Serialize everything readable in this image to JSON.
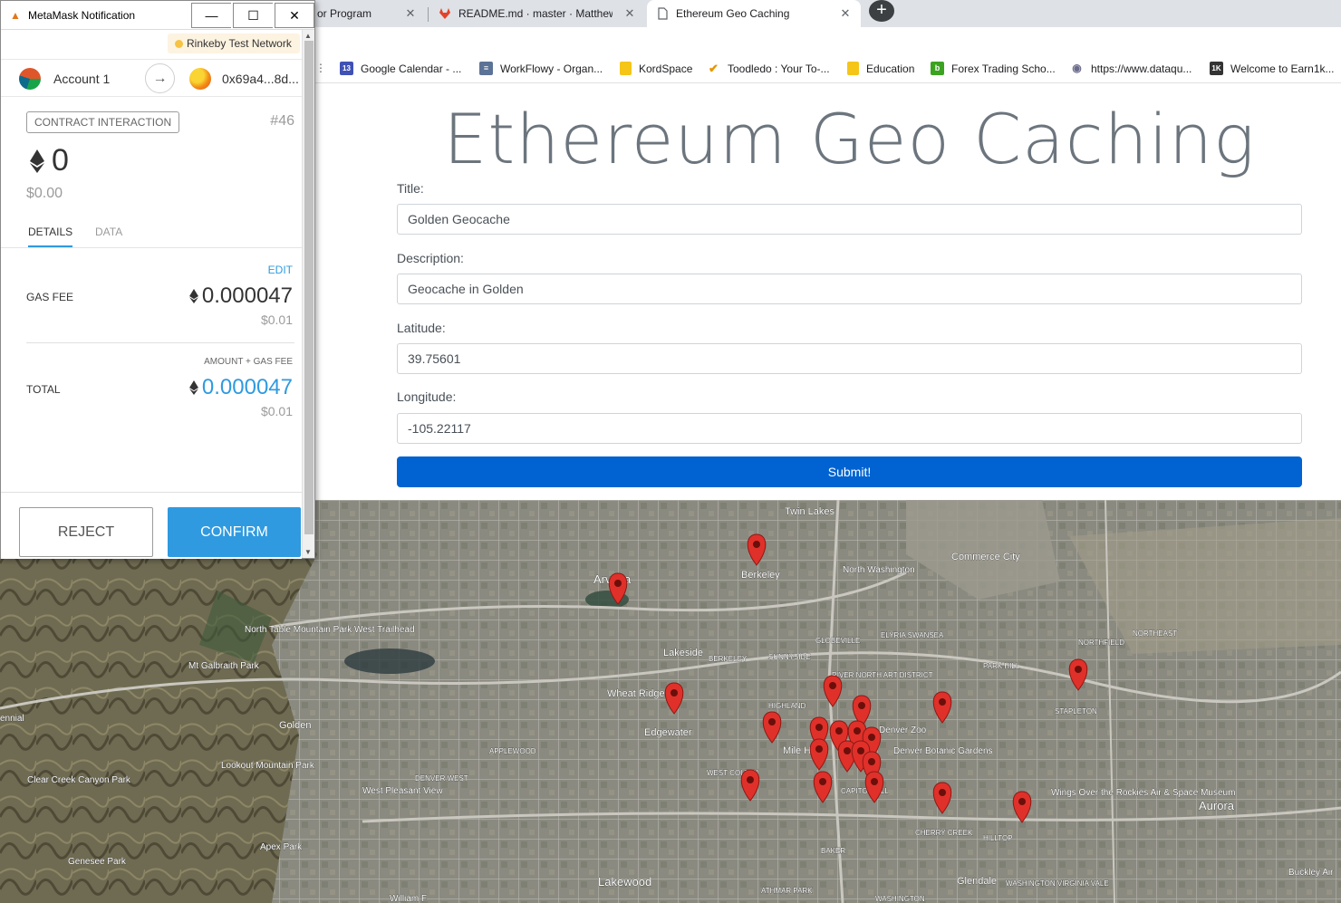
{
  "browser": {
    "tabs": [
      {
        "title": "or Program",
        "close": "✕"
      },
      {
        "title": "README.md · master · Matthew /",
        "close": "✕"
      },
      {
        "title": "Ethereum Geo Caching",
        "close": "✕"
      }
    ],
    "new_tab": "+",
    "bookmarks": [
      {
        "label": "Google Calendar - ...",
        "icon": "calendar-icon",
        "icon_text": "13",
        "color": "#3f51b5"
      },
      {
        "label": "WorkFlowy - Organ...",
        "icon": "workflowy-icon",
        "icon_text": "≡",
        "color": "#5b7396"
      },
      {
        "label": "KordSpace",
        "icon": "folder-icon",
        "icon_text": "",
        "color": "#f5c518"
      },
      {
        "label": "Toodledo : Your To-...",
        "icon": "check-icon",
        "icon_text": "✔",
        "color": "#e69500"
      },
      {
        "label": "Education",
        "icon": "folder-icon",
        "icon_text": "",
        "color": "#f5c518"
      },
      {
        "label": "Forex Trading Scho...",
        "icon": "b-icon",
        "icon_text": "b",
        "color": "#3ba321"
      },
      {
        "label": "https://www.dataqu...",
        "icon": "globe-icon",
        "icon_text": "◉",
        "color": "#6b6b8c"
      },
      {
        "label": "Welcome to Earn1k...",
        "icon": "1k-icon",
        "icon_text": "1K",
        "color": "#333333"
      }
    ]
  },
  "page": {
    "title": "Ethereum Geo Caching",
    "form": {
      "title_label": "Title:",
      "title_value": "Golden Geocache",
      "description_label": "Description:",
      "description_value": "Geocache in Golden",
      "latitude_label": "Latitude:",
      "latitude_value": "39.75601",
      "longitude_label": "Longitude:",
      "longitude_value": "-105.22117",
      "submit_label": "Submit!"
    }
  },
  "map": {
    "places": [
      "Twin Lakes",
      "Arvada",
      "Berkeley",
      "North Washington",
      "Commerce City",
      "North Table Mountain Park West Trailhead",
      "Mt Galbraith Park",
      "Lakeside",
      "BERKELEY",
      "SUNNYSIDE",
      "GLOBEVILLE",
      "ELYRIA SWANSEA",
      "NORTHEAST",
      "NORTHFIELD",
      "Wheat Ridge",
      "HIGHLAND",
      "RIVER NORTH ART DISTRICT",
      "PARK HILL",
      "STAPLETON",
      "Golden",
      "Edgewater",
      "Denver Zoo",
      "Lookout Mountain Park",
      "APPLEWOOD",
      "Mile High",
      "Denver Botanic Gardens",
      "WEST COLFAX",
      "DENVER WEST",
      "Clear Creek Canyon Park",
      "West Pleasant View",
      "CAPITOL HILL",
      "Wings Over the Rockies Air & Space Museum",
      "Aurora",
      "CHERRY CREEK",
      "HILLTOP",
      "Apex Park",
      "BAKER",
      "Genesee Park",
      "Lakewood",
      "Glendale",
      "WASHINGTON VIRGINIA VALE",
      "ATHMAR PARK",
      "WASHINGTON",
      "William F",
      "Buckley Air",
      "ennial"
    ],
    "pin_color": "#e0302a"
  },
  "metamask": {
    "window_title": "MetaMask Notification",
    "minimize": "—",
    "maximize": "☐",
    "close": "✕",
    "network": "Rinkeby Test Network",
    "account_name": "Account 1",
    "arrow": "→",
    "to_address": "0x69a4...8d...",
    "badge": "CONTRACT INTERACTION",
    "nonce": "#46",
    "amount_eth": "0",
    "amount_usd": "$0.00",
    "tab_details": "DETAILS",
    "tab_data": "DATA",
    "edit": "EDIT",
    "gas_fee_label": "GAS FEE",
    "gas_fee_eth": "0.000047",
    "gas_fee_usd": "$0.01",
    "amount_plus_gas": "AMOUNT + GAS FEE",
    "total_label": "TOTAL",
    "total_eth": "0.000047",
    "total_usd": "$0.01",
    "reject": "REJECT",
    "confirm": "CONFIRM",
    "accent": "#2f9ae0"
  }
}
